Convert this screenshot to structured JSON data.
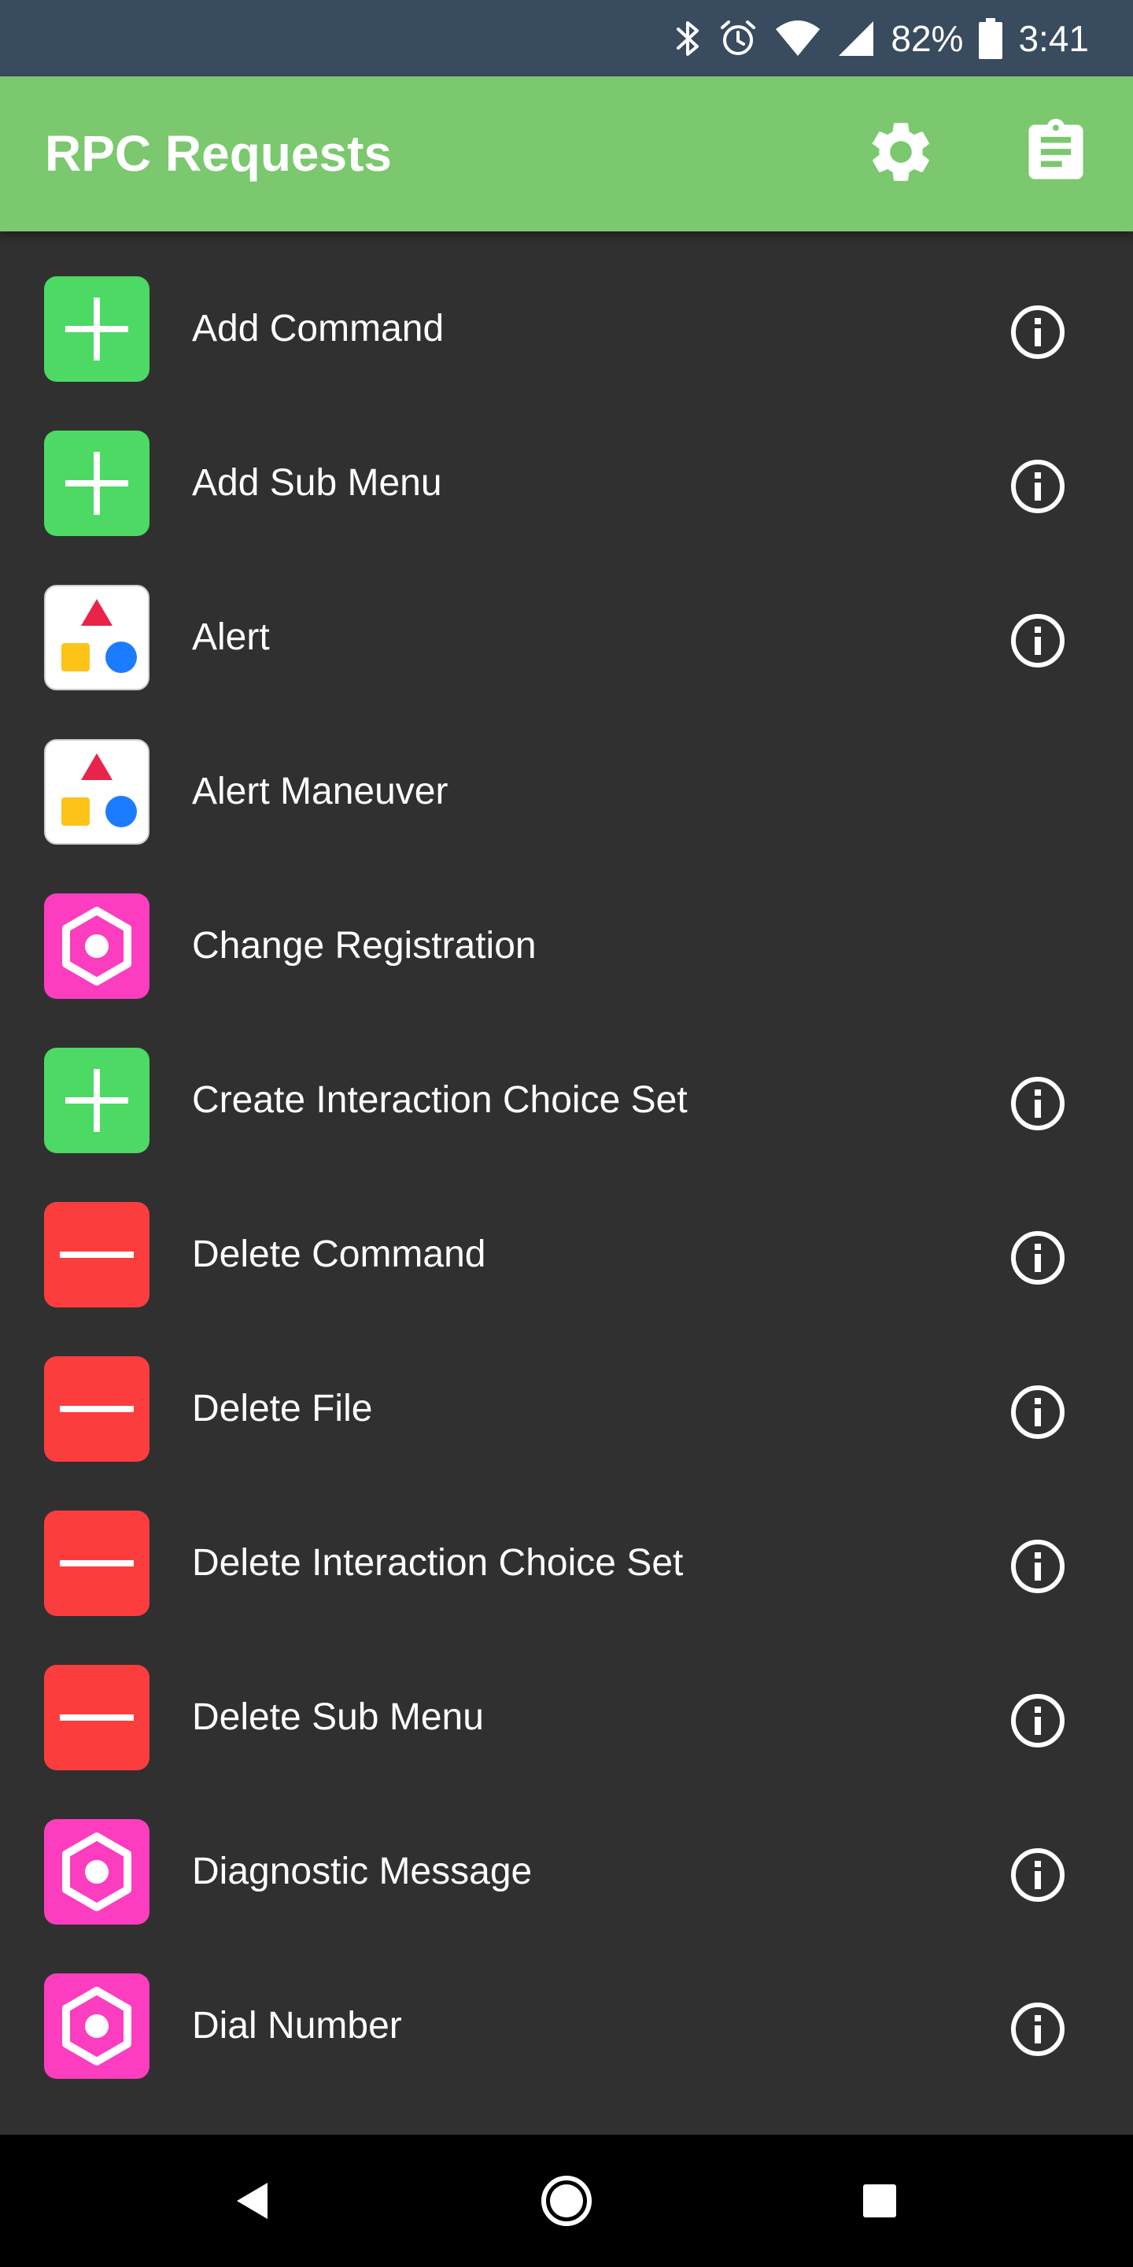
{
  "status_bar": {
    "battery_percent": "82%",
    "time": "3:41",
    "icons": [
      "bluetooth-icon",
      "alarm-icon",
      "wifi-icon",
      "cell-signal-icon",
      "battery-icon"
    ]
  },
  "app_bar": {
    "title": "RPC Requests",
    "color": "#7bc86f",
    "actions": [
      "settings-icon",
      "clipboard-icon"
    ]
  },
  "colors": {
    "background": "#303030",
    "status_bar": "#384b5f",
    "add_tile": "#4cd964",
    "delete_tile": "#fc3d3d",
    "misc_tile": "#fc3dbf",
    "alert_tile": "#ffffff"
  },
  "list": {
    "items": [
      {
        "label": "Add Command",
        "icon": "add-icon",
        "has_info": true
      },
      {
        "label": "Add Sub Menu",
        "icon": "add-icon",
        "has_info": true
      },
      {
        "label": "Alert",
        "icon": "shapes-icon",
        "has_info": true
      },
      {
        "label": "Alert Maneuver",
        "icon": "shapes-icon",
        "has_info": false
      },
      {
        "label": "Change Registration",
        "icon": "hexagon-icon",
        "has_info": false
      },
      {
        "label": "Create Interaction Choice Set",
        "icon": "add-icon",
        "has_info": true
      },
      {
        "label": "Delete Command",
        "icon": "remove-icon",
        "has_info": true
      },
      {
        "label": "Delete File",
        "icon": "remove-icon",
        "has_info": true
      },
      {
        "label": "Delete Interaction Choice Set",
        "icon": "remove-icon",
        "has_info": true
      },
      {
        "label": "Delete Sub Menu",
        "icon": "remove-icon",
        "has_info": true
      },
      {
        "label": "Diagnostic Message",
        "icon": "hexagon-icon",
        "has_info": true
      },
      {
        "label": "Dial Number",
        "icon": "hexagon-icon",
        "has_info": true
      }
    ]
  },
  "nav_bar": {
    "buttons": [
      "back-icon",
      "home-icon",
      "recents-icon"
    ]
  }
}
